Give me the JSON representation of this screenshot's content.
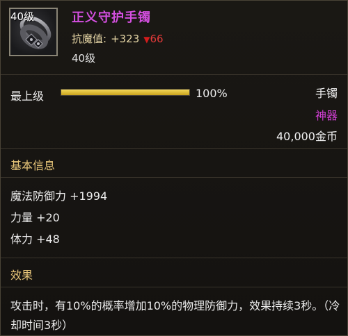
{
  "item": {
    "level_badge": "40级",
    "name": "正义守护手镯",
    "resist_label": "抗魔值:",
    "resist_plus": "+323",
    "resist_down_arrow": "▼",
    "resist_down_value": "66",
    "required_level": "40级"
  },
  "upgrade": {
    "label": "最上级",
    "percent_text": "100%",
    "fill_fraction": 1.0,
    "bar_color": "#e5c23a"
  },
  "meta": {
    "slot_type": "手镯",
    "rarity": "神器",
    "rarity_color": "#d33fd6",
    "price": "40,000金币"
  },
  "basic_info": {
    "title": "基本信息",
    "stats": [
      "魔法防御力 +1994",
      "力量 +20",
      "体力 +48"
    ]
  },
  "effect": {
    "title": "效果",
    "text": "攻击时，有10%的概率增加10%的物理防御力，效果持续3秒。（冷却时间3秒）"
  },
  "colors": {
    "item_name": "#d44fe0",
    "section_title": "#e9c77a",
    "resist_down": "#e33a3a"
  },
  "icon": "bracelet-icon"
}
